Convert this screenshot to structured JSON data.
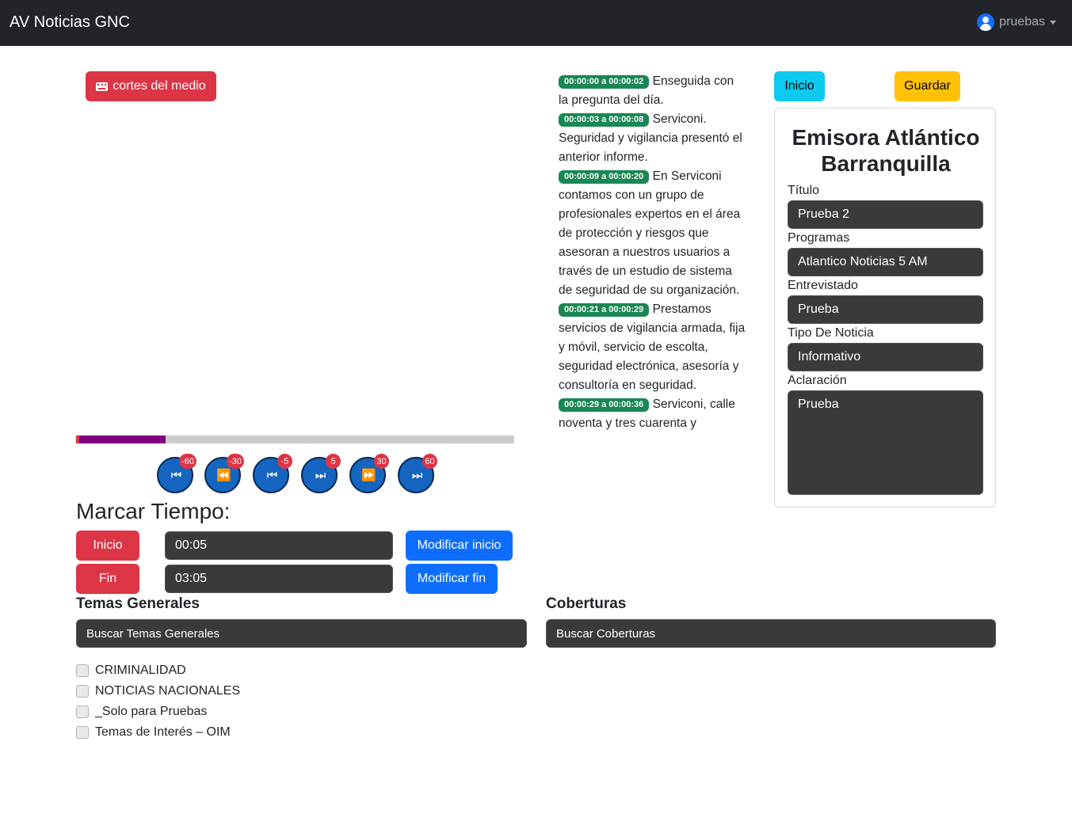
{
  "navbar": {
    "brand": "AV Noticias GNC",
    "user": "pruebas"
  },
  "media": {
    "cortes_label": "cortes del medio",
    "progress": 0.205,
    "controls": [
      {
        "name": "back-60",
        "badge": "-60",
        "icon": "skip-start-icon"
      },
      {
        "name": "back-30",
        "badge": "-30",
        "icon": "rewind-icon"
      },
      {
        "name": "back-5",
        "badge": "-5",
        "icon": "step-back-icon"
      },
      {
        "name": "fwd-5",
        "badge": "5",
        "icon": "step-forward-icon"
      },
      {
        "name": "fwd-30",
        "badge": "30",
        "icon": "fast-forward-icon"
      },
      {
        "name": "fwd-60",
        "badge": "60",
        "icon": "skip-end-icon"
      }
    ]
  },
  "marcar": {
    "title": "Marcar Tiempo:",
    "inicio_label": "Inicio",
    "inicio_value": "00:05",
    "modificar_inicio": "Modificar inicio",
    "fin_label": "Fin",
    "fin_value": "03:05",
    "modificar_fin": "Modificar fin"
  },
  "transcript": [
    {
      "time": "00:00:00 a 00:00:02",
      "text": "Enseguida con la pregunta del día."
    },
    {
      "time": "00:00:03 a 00:00:08",
      "text": "Serviconi. Seguridad y vigilancia presentó el anterior informe."
    },
    {
      "time": "00:00:09 a 00:00:20",
      "text": "En Serviconi contamos con un grupo de profesionales expertos en el área de protección y riesgos que asesoran a nuestros usuarios a través de un estudio de sistema de seguridad de su organización."
    },
    {
      "time": "00:00:21 a 00:00:29",
      "text": "Prestamos servicios de vigilancia armada, fija y móvil, servicio de escolta, seguridad electrónica, asesoría y consultoría en seguridad."
    },
    {
      "time": "00:00:29 a 00:00:36",
      "text": "Serviconi, calle noventa y tres cuarenta y"
    }
  ],
  "actions": {
    "inicio": "Inicio",
    "guardar": "Guardar"
  },
  "card": {
    "title": "Emisora Atlántico Barranquilla",
    "fields": [
      {
        "label": "Título",
        "value": "Prueba 2"
      },
      {
        "label": "Programas",
        "value": "Atlantico Noticias 5 AM"
      },
      {
        "label": "Entrevistado",
        "value": "Prueba"
      },
      {
        "label": "Tipo De Noticia",
        "value": "Informativo"
      },
      {
        "label": "Aclaración",
        "value": "Prueba"
      }
    ]
  },
  "temas": {
    "title": "Temas Generales",
    "search_placeholder": "Buscar Temas Generales",
    "items": [
      "CRIMINALIDAD",
      "NOTICIAS NACIONALES",
      "_Solo para Pruebas",
      "Temas de Interés – OIM"
    ]
  },
  "coberturas": {
    "title": "Coberturas",
    "search_placeholder": "Buscar Coberturas"
  },
  "colors": {
    "navbar": "#212529",
    "danger": "#dc3545",
    "primary": "#0d6efd",
    "info": "#0dcaf0",
    "warning": "#ffc107",
    "timestamp": "#198754",
    "progress_fill": "#800080"
  }
}
